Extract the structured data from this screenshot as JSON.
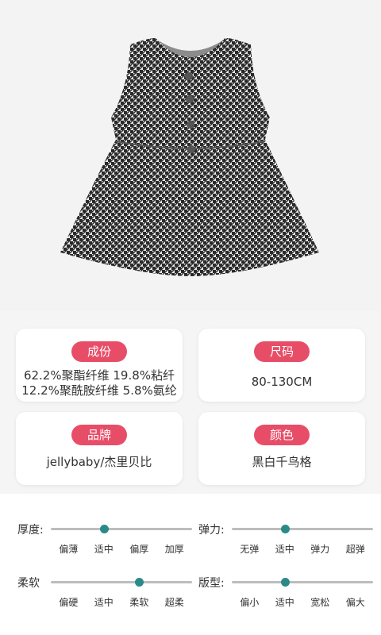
{
  "product_image": {
    "description_icon": "houndstooth-sleeveless-dress-icon"
  },
  "attributes": [
    {
      "title": "成份",
      "lines": [
        "62.2%聚酯纤维 19.8%粘纤",
        "12.2%聚酰胺纤维 5.8%氨纶"
      ]
    },
    {
      "title": "尺码",
      "lines": [
        "80-130CM"
      ]
    },
    {
      "title": "品牌",
      "lines": [
        "jellybaby/杰里贝比"
      ]
    },
    {
      "title": "颜色",
      "lines": [
        "黑白千鸟格"
      ]
    }
  ],
  "ratings": [
    {
      "label": "厚度:",
      "options": [
        "偏薄",
        "适中",
        "偏厚",
        "加厚"
      ],
      "selected_index": 1
    },
    {
      "label": "弹力:",
      "options": [
        "无弹",
        "适中",
        "弹力",
        "超弹"
      ],
      "selected_index": 1
    },
    {
      "label": "柔软",
      "options": [
        "偏硬",
        "适中",
        "柔软",
        "超柔"
      ],
      "selected_index": 2
    },
    {
      "label": "版型:",
      "options": [
        "偏小",
        "适中",
        "宽松",
        "偏大"
      ],
      "selected_index": 1
    }
  ],
  "colors": {
    "pill": "#e84d68",
    "knob": "#2b8a87",
    "track": "#bdbdbd",
    "hero_bg": "#f3f3f3"
  }
}
